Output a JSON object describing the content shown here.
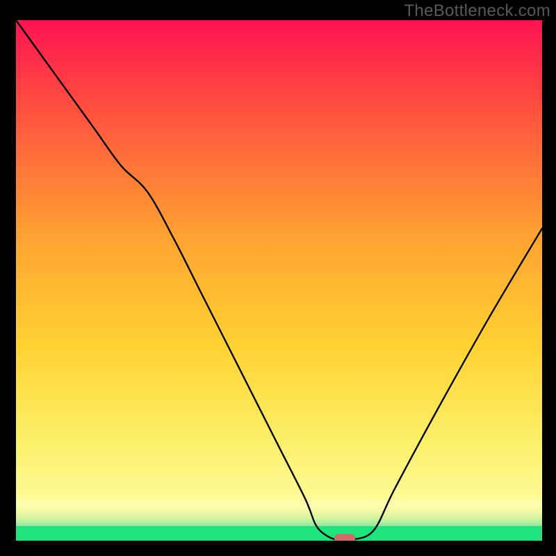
{
  "watermark": "TheBottleneck.com",
  "chart_data": {
    "type": "line",
    "title": "",
    "xlabel": "",
    "ylabel": "",
    "xlim": [
      0,
      100
    ],
    "ylim": [
      0,
      100
    ],
    "grid": false,
    "series": [
      {
        "name": "curve",
        "x": [
          0,
          5,
          10,
          15,
          20,
          25,
          30,
          35,
          40,
          45,
          50,
          55,
          57,
          59,
          61,
          64,
          68,
          72,
          80,
          90,
          100
        ],
        "values": [
          100,
          93,
          86,
          79,
          72,
          67,
          58,
          48,
          38,
          28,
          18,
          8,
          3,
          1,
          0.2,
          0.2,
          2,
          10,
          25,
          43,
          60
        ]
      }
    ],
    "marker": {
      "x": 62.5,
      "y": 0.4,
      "color": "#d16a6a"
    },
    "gradient_bands": [
      {
        "y_from": 100,
        "y_to": 30,
        "type": "linear",
        "from_color": "#ff1452",
        "to_color": "#ffe232"
      },
      {
        "y_from": 30,
        "y_to": 8,
        "type": "linear",
        "from_color": "#ffe232",
        "to_color": "#fefb97"
      },
      {
        "y_from": 8,
        "y_to": 3,
        "type": "linear",
        "from_color": "#f6fba5",
        "to_color": "#8de9a3"
      },
      {
        "y_from": 3,
        "y_to": 0,
        "type": "solid",
        "color": "#21e37e"
      }
    ]
  }
}
